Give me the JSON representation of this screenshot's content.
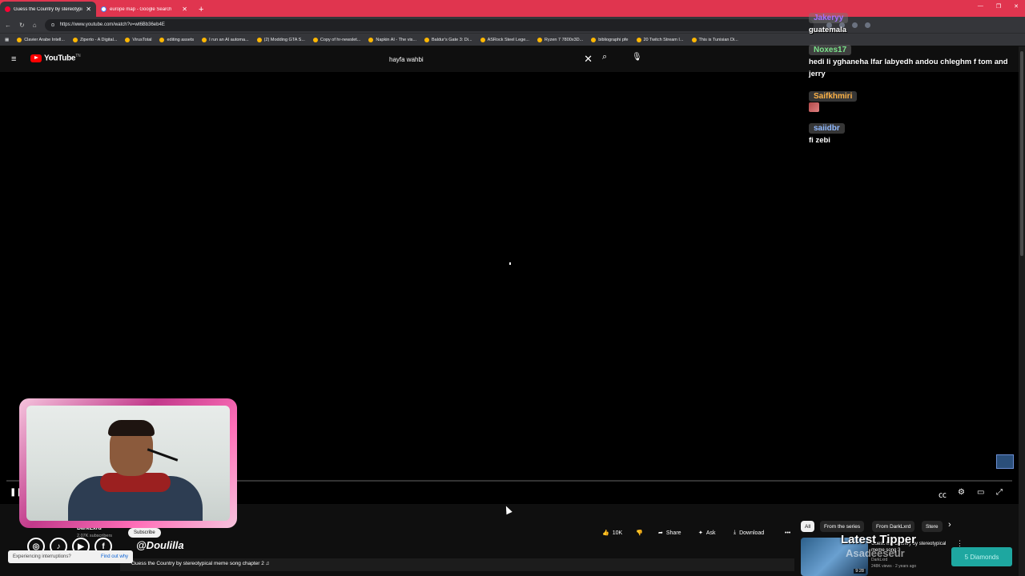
{
  "browser": {
    "tabs": [
      {
        "title": "Guess the Country by stereotypical",
        "active": true
      },
      {
        "title": "europe map - Google Search",
        "active": false
      }
    ],
    "new_tab": "+",
    "url": "https://www.youtube.com/watch?v=wt6Bb36eb4E",
    "bookmarks": [
      "Clavier Arabe Intell...",
      "Ziperto - A Digital...",
      "VirusTotal",
      "editing assets",
      "I run an AI automa...",
      "(2) Modding GTA S...",
      "Copy of hr-newslet...",
      "Napkin AI - The vis...",
      "Baldur's Gate 3: Di...",
      "ASRock Steel Lege...",
      "Ryzen 7 7800x3D...",
      "bibliographi pfe",
      "20 Twitch Stream I...",
      "This is Tunisian Di..."
    ]
  },
  "youtube": {
    "logo": "YouTube",
    "logo_sup": "TN",
    "search_value": "hayfa wahbi",
    "channel": "DarkLxrd",
    "subscribers": "2.07K subscribers",
    "subscribe_label": "Subscribe",
    "video_title": "Guess the Country by stereotypical meme song chapter 2 ♫",
    "like_count": "10K",
    "share_label": "Share",
    "ask_label": "Ask",
    "download_label": "Download",
    "chips": [
      "All",
      "From the series",
      "From DarkLxrd",
      "Stere"
    ],
    "toast_text": "Experiencing interruptions?",
    "toast_link": "Find out why",
    "recommended": {
      "title": "Guess the Country by stereotypical meme song 3",
      "channel": "DarkLxrd",
      "meta": "248K views · 2 years ago",
      "duration": "9:28"
    }
  },
  "overlay": {
    "handle": "@Doulilla",
    "latest_tipper_label": "Latest Tipper",
    "latest_tipper_name": "Asadeeseur",
    "diamonds": "5 Diamonds"
  },
  "chat": [
    {
      "name": "Jakeryy",
      "color": "#a970ff",
      "text": "guatemala"
    },
    {
      "name": "Noxes17",
      "color": "#7be38b",
      "text": "hedi li yghaneha lfar labyedh andou chleghm f tom and jerry"
    },
    {
      "name": "Saifkhmiri",
      "color": "#ffb347",
      "text": ""
    },
    {
      "name": "saiidbr",
      "color": "#8fb8ff",
      "text": "fi zebi"
    }
  ]
}
